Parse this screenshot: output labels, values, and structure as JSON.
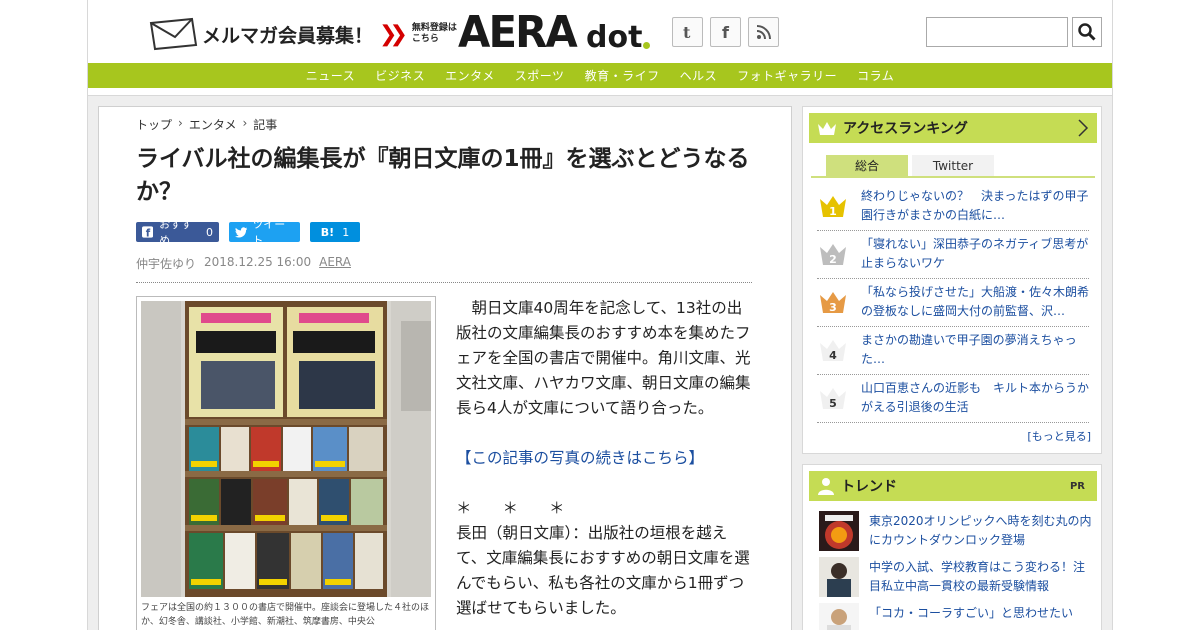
{
  "header": {
    "mailmag_label": "メルマガ会員募集！",
    "mailmag_sub": "無料登録はこちら",
    "logo_main": "AERA",
    "logo_sub": "dot",
    "search_placeholder": ""
  },
  "nav": [
    "ニュース",
    "ビジネス",
    "エンタメ",
    "スポーツ",
    "教育・ライフ",
    "ヘルス",
    "フォトギャラリー",
    "コラム"
  ],
  "article": {
    "breadcrumb": [
      "トップ",
      "エンタメ",
      "記事"
    ],
    "title": "ライバル社の編集長が『朝日文庫の1冊』を選ぶとどうなるか？",
    "share": {
      "fb_label": "おすすめ",
      "fb_count": "0",
      "tw_label": "ツイート",
      "hb_label": "B!",
      "hb_count": "1"
    },
    "author": "仲宇佐ゆり",
    "datetime": "2018.12.25 16:00",
    "source": "AERA",
    "photo_caption": "フェアは全国の約１３００の書店で開催中。座談会に登場した４社のほか、幻冬舎、講談社、小学館、新潮社、筑摩書房、中央公",
    "paragraph1": "朝日文庫40周年を記念して、13社の出版社の文庫編集長のおすすめ本を集めたフェアを全国の書店で開催中。角川文庫、光文社文庫、ハヤカワ文庫、朝日文庫の編集長ら4人が文庫について語り合った。",
    "photo_link": "【この記事の写真の続きはこちら】",
    "asterisks": "＊　　＊　　＊",
    "paragraph2": "長田（朝日文庫）：出版社の垣根を越えて、文庫編集長におすすめの朝日文庫を選んでもらい、私も各社の文庫から1冊ずつ選ばせてもらいました。"
  },
  "sidebar": {
    "ranking_title": "アクセスランキング",
    "tabs": [
      "総合",
      "Twitter"
    ],
    "ranking": [
      {
        "rank": "1",
        "text": "終わりじゃないの？　決まったはずの甲子園行きがまさかの白紙に…"
      },
      {
        "rank": "2",
        "text": "「寝れない」深田恭子のネガティブ思考が止まらないワケ"
      },
      {
        "rank": "3",
        "text": "「私なら投げさせた」大船渡・佐々木朗希の登板なしに盛岡大付の前監督、沢…"
      },
      {
        "rank": "4",
        "text": "まさかの勘違いで甲子園の夢消えちゃった…"
      },
      {
        "rank": "5",
        "text": "山口百恵さんの近影も　キルト本からうかがえる引退後の生活"
      }
    ],
    "more_label": "[もっと見る]",
    "trend_title": "トレンド",
    "pr_label": "PR",
    "trends": [
      {
        "text": "東京2020オリンピックへ時を刻む丸の内にカウントダウンロック登場"
      },
      {
        "text": "中学の入試、学校教育はこう変わる！注目私立中高一貫校の最新受験情報"
      },
      {
        "text": "「コカ・コーラすごい」と思わせたい"
      }
    ]
  },
  "colors": {
    "brand_green": "#a7c61e",
    "link_blue": "#1c4fa0",
    "rank_gold": "#e6c200",
    "rank_silver": "#bdbdbd",
    "rank_bronze": "#e69a45"
  }
}
